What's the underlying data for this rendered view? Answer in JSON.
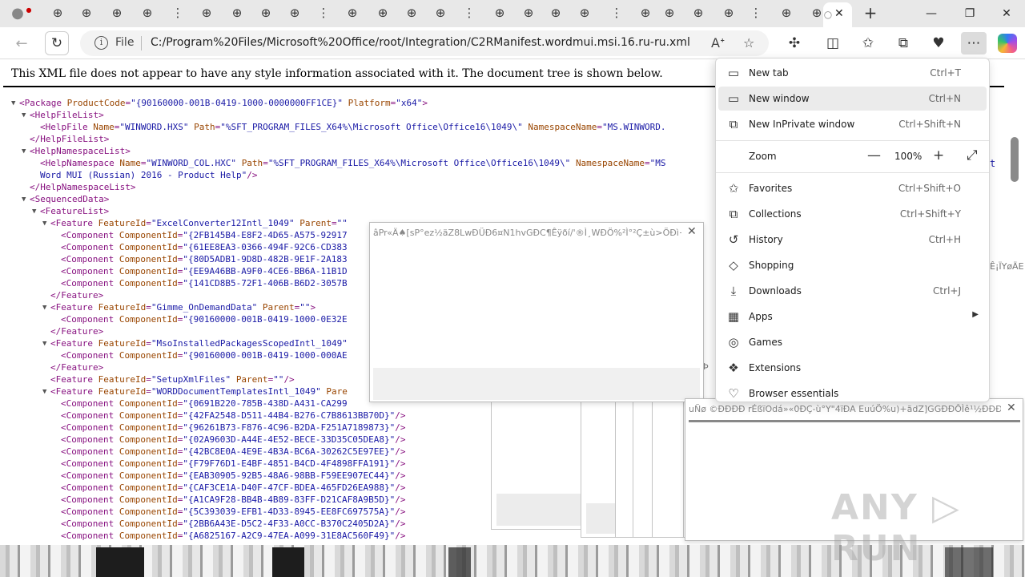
{
  "tabs": {
    "fragments": [
      "",
      "",
      "",
      "",
      "",
      "",
      "",
      "",
      "",
      "",
      "",
      "",
      "",
      "",
      "",
      "",
      "",
      "",
      "",
      ""
    ],
    "active_close": "✕",
    "new_tab": "+"
  },
  "window": {
    "minimize": "—",
    "restore": "❐",
    "close": "✕"
  },
  "address": {
    "file_label": "File",
    "url": "C:/Program%20Files/Microsoft%20Office/root/Integration/C2RManifest.wordmui.msi.16.ru-ru.xml"
  },
  "page": {
    "notice": "This XML file does not appear to have any style information associated with it. The document tree is shown below.",
    "lines": [
      {
        "indent": 0,
        "toggle": "▼",
        "html": "<span class=\"tag\">&lt;Package</span> <span class=\"att\">ProductCode</span>=<span class=\"val\">\"{90160000-001B-0419-1000-0000000FF1CE}\"</span> <span class=\"att\">Platform</span>=<span class=\"val\">\"x64\"</span>&gt;"
      },
      {
        "indent": 1,
        "toggle": "▼",
        "html": "&lt;HelpFileList&gt;"
      },
      {
        "indent": 2,
        "toggle": "",
        "html": "&lt;HelpFile <span class=\"att\">Name</span>=<span class=\"val\">\"WINWORD.HXS\"</span> <span class=\"att\">Path</span>=<span class=\"val\">\"%SFT_PROGRAM_FILES_X64%\\Microsoft Office\\Office16\\1049\\\"</span> <span class=\"att\">NamespaceName</span>=<span class=\"val\">\"MS.WINWORD.</span>"
      },
      {
        "indent": 1,
        "toggle": "",
        "html": "&lt;/HelpFileList&gt;"
      },
      {
        "indent": 1,
        "toggle": "▼",
        "html": "&lt;HelpNamespaceList&gt;"
      },
      {
        "indent": 2,
        "toggle": "",
        "html": "&lt;HelpNamespace <span class=\"att\">Name</span>=<span class=\"val\">\"WINWORD_COL.HXC\"</span> <span class=\"att\">Path</span>=<span class=\"val\">\"%SFT_PROGRAM_FILES_X64%\\Microsoft Office\\Office16\\1049\\\"</span> <span class=\"att\">NamespaceName</span>=<span class=\"val\">\"MS</span>"
      },
      {
        "indent": 2,
        "toggle": "",
        "html": "<span class=\"val\">Word MUI (Russian) 2016 - Product Help\"</span>/&gt;"
      },
      {
        "indent": 1,
        "toggle": "",
        "html": "&lt;/HelpNamespaceList&gt;"
      },
      {
        "indent": 1,
        "toggle": "▼",
        "html": "&lt;SequencedData&gt;"
      },
      {
        "indent": 2,
        "toggle": "▼",
        "html": "&lt;FeatureList&gt;"
      },
      {
        "indent": 3,
        "toggle": "▼",
        "html": "&lt;Feature <span class=\"att\">FeatureId</span>=<span class=\"val\">\"ExcelConverter12Intl_1049\"</span> <span class=\"att\">Parent</span>=<span class=\"val\">\"\"</span>"
      },
      {
        "indent": 4,
        "toggle": "",
        "html": "&lt;Component <span class=\"att\">ComponentId</span>=<span class=\"val\">\"{2FB145B4-E8F2-4D65-A575-92917</span>"
      },
      {
        "indent": 4,
        "toggle": "",
        "html": "&lt;Component <span class=\"att\">ComponentId</span>=<span class=\"val\">\"{61EE8EA3-0366-494F-92C6-CD383</span>"
      },
      {
        "indent": 4,
        "toggle": "",
        "html": "&lt;Component <span class=\"att\">ComponentId</span>=<span class=\"val\">\"{80D5ADB1-9D8D-482B-9E1F-2A183</span>"
      },
      {
        "indent": 4,
        "toggle": "",
        "html": "&lt;Component <span class=\"att\">ComponentId</span>=<span class=\"val\">\"{EE9A46BB-A9F0-4CE6-BB6A-11B1D</span>"
      },
      {
        "indent": 4,
        "toggle": "",
        "html": "&lt;Component <span class=\"att\">ComponentId</span>=<span class=\"val\">\"{141CD8B5-72F1-406B-B6D2-3057B</span>"
      },
      {
        "indent": 3,
        "toggle": "",
        "html": "&lt;/Feature&gt;"
      },
      {
        "indent": 3,
        "toggle": "▼",
        "html": "&lt;Feature <span class=\"att\">FeatureId</span>=<span class=\"val\">\"Gimme_OnDemandData\"</span> <span class=\"att\">Parent</span>=<span class=\"val\">\"\"</span>&gt;"
      },
      {
        "indent": 4,
        "toggle": "",
        "html": "&lt;Component <span class=\"att\">ComponentId</span>=<span class=\"val\">\"{90160000-001B-0419-1000-0E32E</span>"
      },
      {
        "indent": 3,
        "toggle": "",
        "html": "&lt;/Feature&gt;"
      },
      {
        "indent": 3,
        "toggle": "▼",
        "html": "&lt;Feature <span class=\"att\">FeatureId</span>=<span class=\"val\">\"MsoInstalledPackagesScopedIntl_1049\"</span>"
      },
      {
        "indent": 4,
        "toggle": "",
        "html": "&lt;Component <span class=\"att\">ComponentId</span>=<span class=\"val\">\"{90160000-001B-0419-1000-000AE</span>"
      },
      {
        "indent": 3,
        "toggle": "",
        "html": "&lt;/Feature&gt;"
      },
      {
        "indent": 3,
        "toggle": "",
        "html": "&lt;Feature <span class=\"att\">FeatureId</span>=<span class=\"val\">\"SetupXmlFiles\"</span> <span class=\"att\">Parent</span>=<span class=\"val\">\"\"</span>/&gt;"
      },
      {
        "indent": 3,
        "toggle": "▼",
        "html": "&lt;Feature <span class=\"att\">FeatureId</span>=<span class=\"val\">\"WORDDocumentTemplatesIntl_1049\"</span> <span class=\"att\">Pare</span>"
      },
      {
        "indent": 4,
        "toggle": "",
        "html": "&lt;Component <span class=\"att\">ComponentId</span>=<span class=\"val\">\"{0691B220-785B-438D-A431-CA299</span>"
      },
      {
        "indent": 4,
        "toggle": "",
        "html": "&lt;Component <span class=\"att\">ComponentId</span>=<span class=\"val\">\"{42FA2548-D511-44B4-B276-C7B8613BB70D}\"</span>/&gt;"
      },
      {
        "indent": 4,
        "toggle": "",
        "html": "&lt;Component <span class=\"att\">ComponentId</span>=<span class=\"val\">\"{96261B73-F876-4C96-B2DA-F251A7189873}\"</span>/&gt;"
      },
      {
        "indent": 4,
        "toggle": "",
        "html": "&lt;Component <span class=\"att\">ComponentId</span>=<span class=\"val\">\"{02A9603D-A44E-4E52-BECE-33D35C05DEA8}\"</span>/&gt;"
      },
      {
        "indent": 4,
        "toggle": "",
        "html": "&lt;Component <span class=\"att\">ComponentId</span>=<span class=\"val\">\"{42BC8E0A-4E9E-4B3A-BC6A-30262C5E97EE}\"</span>/&gt;"
      },
      {
        "indent": 4,
        "toggle": "",
        "html": "&lt;Component <span class=\"att\">ComponentId</span>=<span class=\"val\">\"{F79F76D1-E4BF-4851-B4CD-4F4898FFA191}\"</span>/&gt;"
      },
      {
        "indent": 4,
        "toggle": "",
        "html": "&lt;Component <span class=\"att\">ComponentId</span>=<span class=\"val\">\"{EAB30905-92B5-48A6-98BB-F59EE907EC44}\"</span>/&gt;"
      },
      {
        "indent": 4,
        "toggle": "",
        "html": "&lt;Component <span class=\"att\">ComponentId</span>=<span class=\"val\">\"{CAF3CE1A-D40F-47CF-BDEA-465FD26EA988}\"</span>/&gt;"
      },
      {
        "indent": 4,
        "toggle": "",
        "html": "&lt;Component <span class=\"att\">ComponentId</span>=<span class=\"val\">\"{A1CA9F28-BB4B-4B89-83FF-D21CAF8A9B5D}\"</span>/&gt;"
      },
      {
        "indent": 4,
        "toggle": "",
        "html": "&lt;Component <span class=\"att\">ComponentId</span>=<span class=\"val\">\"{5C393039-EFB1-4D33-8945-EE8FC697575A}\"</span>/&gt;"
      },
      {
        "indent": 4,
        "toggle": "",
        "html": "&lt;Component <span class=\"att\">ComponentId</span>=<span class=\"val\">\"{2BB6A43E-D5C2-4F33-A0CC-B370C2405D2A}\"</span>/&gt;"
      },
      {
        "indent": 4,
        "toggle": "",
        "html": "&lt;Component <span class=\"att\">ComponentId</span>=<span class=\"val\">\"{A6825167-A2C9-47EA-A099-31E8AC560F49}\"</span>/&gt;"
      }
    ]
  },
  "popup1": {
    "title": "âPr«Ä♠[sP°ez½äZ8LwÐÜÐ6¤N1hvGÐC¶Êÿðí/'®Ì¸WÐÖ%²Ì°²Ç±ù>ÖÐì+l...",
    "close": "✕"
  },
  "popup2": {
    "title": "uÑø ©ÐÐÐÐ rÉßïOdá»«0ÐÇ-ù°Y\"4ïÐA EuúÖ%u)+ãdZ]GGÐÐÔÌê¹½ÐÐÐ...",
    "close": "✕"
  },
  "side_fragments": [
    "t",
    "Ê¡ÏYøÄE",
    "Þ"
  ],
  "menu": {
    "items": [
      {
        "icon": "▭",
        "label": "New tab",
        "shortcut": "Ctrl+T"
      },
      {
        "icon": "▭",
        "label": "New window",
        "shortcut": "Ctrl+N"
      },
      {
        "icon": "⧉",
        "label": "New InPrivate window",
        "shortcut": "Ctrl+Shift+N"
      }
    ],
    "zoom": {
      "label": "Zoom",
      "minus": "—",
      "value": "100%",
      "plus": "+",
      "fullscreen": "⤢"
    },
    "items2": [
      {
        "icon": "✩",
        "label": "Favorites",
        "shortcut": "Ctrl+Shift+O"
      },
      {
        "icon": "⧉",
        "label": "Collections",
        "shortcut": "Ctrl+Shift+Y"
      },
      {
        "icon": "↺",
        "label": "History",
        "shortcut": "Ctrl+H"
      },
      {
        "icon": "◇",
        "label": "Shopping",
        "shortcut": ""
      },
      {
        "icon": "⤓",
        "label": "Downloads",
        "shortcut": "Ctrl+J"
      },
      {
        "icon": "▦",
        "label": "Apps",
        "shortcut": ""
      },
      {
        "icon": "◎",
        "label": "Games",
        "shortcut": ""
      },
      {
        "icon": "❖",
        "label": "Extensions",
        "shortcut": ""
      },
      {
        "icon": "♡",
        "label": "Browser essentials",
        "shortcut": ""
      }
    ]
  },
  "watermark": "ANY ▷ RUN"
}
